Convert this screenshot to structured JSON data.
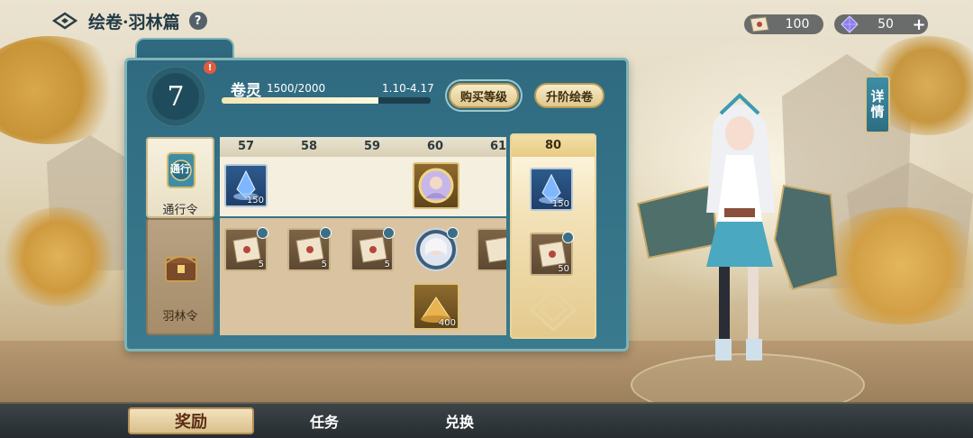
{
  "header": {
    "title": "绘卷·羽林篇",
    "help": "?"
  },
  "currency": {
    "ticket_value": "100",
    "gem_value": "50",
    "gem_plus": "+"
  },
  "detail_button": "详情",
  "level": {
    "number": "7",
    "alert": "!"
  },
  "spirit": {
    "label": "卷灵",
    "progress_text": "1500/2000",
    "progress_fraction": 0.75,
    "date_range": "1.10-4.17"
  },
  "buttons": {
    "buy_level": "购买等级",
    "upgrade": "升阶绘卷"
  },
  "tabs": {
    "pass": "通行令",
    "pass_icon_text": "通行",
    "yulin": "羽林令"
  },
  "levels": [
    "57",
    "58",
    "59",
    "60",
    "61"
  ],
  "highlight_level": "80",
  "free_rewards": [
    {
      "level": "57",
      "icon": "blue-crystal-icon",
      "count": "150"
    },
    {
      "level": "60",
      "icon": "avatar-frame-icon",
      "count": ""
    }
  ],
  "paid_rewards": [
    {
      "level": "57",
      "icon": "scroll-ticket-icon",
      "count": "5"
    },
    {
      "level": "58",
      "icon": "scroll-ticket-icon",
      "count": "5"
    },
    {
      "level": "59",
      "icon": "scroll-ticket-icon",
      "count": "5"
    },
    {
      "level": "60",
      "icon": "hero-portrait-icon",
      "count": ""
    },
    {
      "level": "60",
      "icon": "gold-pile-icon",
      "count": "400"
    }
  ],
  "highlight_rewards": {
    "free": {
      "icon": "blue-crystal-icon",
      "count": "150"
    },
    "paid": {
      "icon": "scroll-ticket-icon",
      "count": "50"
    }
  },
  "bottom_nav": [
    "奖励",
    "任务",
    "兑换"
  ],
  "colors": {
    "panel": "#2f6a80",
    "gold": "#e1c98d",
    "accent_red": "#e25b3c"
  }
}
